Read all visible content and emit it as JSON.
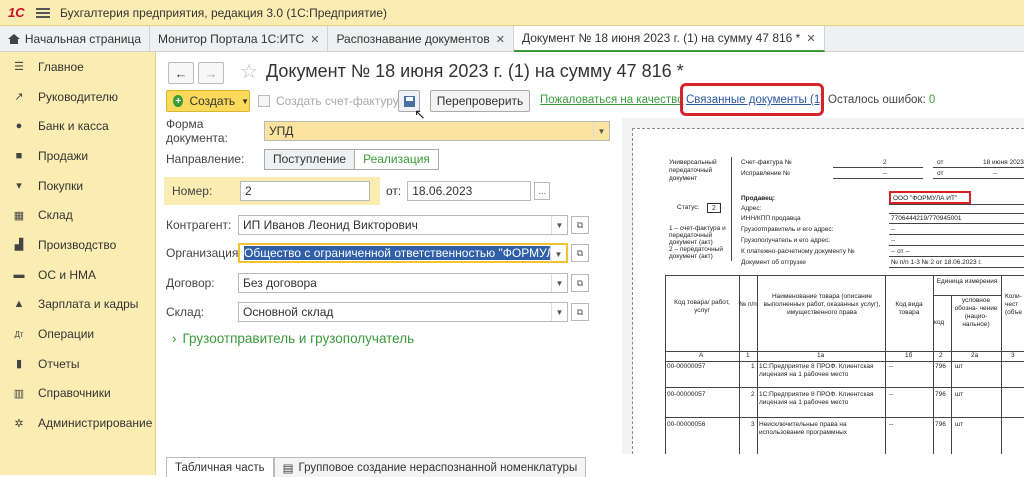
{
  "window": {
    "logo": "1С",
    "title": "Бухгалтерия предприятия, редакция 3.0  (1С:Предприятие)"
  },
  "tabs": [
    {
      "label": "Начальная страница"
    },
    {
      "label": "Монитор Портала 1С:ИТС"
    },
    {
      "label": "Распознавание документов"
    },
    {
      "label": "Документ № 18 июня 2023 г. (1) на сумму 47 816 *"
    }
  ],
  "sidebar": {
    "items": [
      {
        "label": "Главное",
        "icon": "menu-icon"
      },
      {
        "label": "Руководителю",
        "icon": "trend-icon"
      },
      {
        "label": "Банк и касса",
        "icon": "coins-icon"
      },
      {
        "label": "Продажи",
        "icon": "bag-icon"
      },
      {
        "label": "Покупки",
        "icon": "cart-icon"
      },
      {
        "label": "Склад",
        "icon": "warehouse-icon"
      },
      {
        "label": "Производство",
        "icon": "factory-icon"
      },
      {
        "label": "ОС и НМА",
        "icon": "truck-icon"
      },
      {
        "label": "Зарплата и кадры",
        "icon": "people-icon"
      },
      {
        "label": "Операции",
        "icon": "dt-kt-icon"
      },
      {
        "label": "Отчеты",
        "icon": "chart-icon"
      },
      {
        "label": "Справочники",
        "icon": "books-icon"
      },
      {
        "label": "Администрирование",
        "icon": "gear-icon"
      }
    ]
  },
  "header": {
    "title": "Документ № 18 июня 2023 г. (1) на сумму 47 816 *"
  },
  "toolbar": {
    "create": "Создать",
    "invoice": "Создать счет-фактуру",
    "recheck": "Перепроверить",
    "complain": "Пожаловаться на качество",
    "related": "Связанные документы (1)",
    "errors_label": "Осталось ошибок:",
    "errors_value": "0"
  },
  "form": {
    "doc_form_label": "Форма документа:",
    "doc_form_value": "УПД",
    "direction_label": "Направление:",
    "direction_in": "Поступление",
    "direction_out": "Реализация",
    "number_label": "Номер:",
    "number_value": "2",
    "date_label": "от:",
    "date_value": "18.06.2023",
    "date_btn": "...",
    "counterparty_label": "Контрагент:",
    "counterparty_value": "ИП Иванов Леонид Викторович",
    "org_label": "Организация:",
    "org_value": "Общество с ограниченной ответственностью \"ФОРМУЛА И",
    "contract_label": "Договор:",
    "contract_value": "Без договора",
    "warehouse_label": "Склад:",
    "warehouse_value": "Основной склад",
    "expander": "Грузоотправитель и грузополучатель"
  },
  "bottom_tabs": [
    {
      "label": "Табличная часть"
    },
    {
      "label": "Групповое создание нераспознанной номенклатуры"
    }
  ],
  "preview": {
    "upd1": "Универсальный",
    "upd2": "передаточный",
    "upd3": "документ",
    "invoice_no": "Счет-фактура №",
    "invoice_no_val": "2",
    "invoice_from": "от",
    "invoice_date": "18 июня 2023",
    "correction": "Исправление №",
    "correction_val": "--",
    "correction_from": "от",
    "correction_date": "--",
    "status": "Статус:",
    "status_val": "2",
    "seller": "Продавец:",
    "seller_val": "ООО \"ФОРМУЛА ИТ\"",
    "address": "Адрес:",
    "inn": "ИНН/КПП продавца",
    "inn_val": "7706444219/770945001",
    "shipper": "Грузоотправитель и его адрес:",
    "shipper_val": "--",
    "consignee": "Грузополучатель и его адрес:",
    "consignee_val": "--",
    "payment": "К платежно-расчетному документу №",
    "payment_val": "-- от --",
    "shipdoc": "Документ об отгрузке",
    "shipdoc_val": "№ п/п 1-3 № 2 от 18.06.2023 г.",
    "note1": "1 – счет-фактура и",
    "note2": "передаточный",
    "note3": "документ (акт)",
    "note4": "2 – передаточный",
    "note5": "документ (акт)",
    "col_code": "Код товара/ работ, услуг",
    "col_num": "№ п/п",
    "col_name": "Наименование товара (описание выполненных работ, оказанных услуг), имущественного права",
    "col_kind": "Код вида товара",
    "col_unit": "Единица измерения",
    "col_unit_code": "код",
    "col_unit_name": "условное обозна- чение (нацио- нальное)",
    "col_qty": "Коли- чест (объе",
    "row_letters": [
      "А",
      "1",
      "1а",
      "1б",
      "2",
      "2а",
      "3"
    ],
    "rows": [
      {
        "code": "00-00000057",
        "n": "1",
        "name": "1С:Предприятие 8 ПРОФ. Клиентская лицензия на 1 рабочее место",
        "kind": "--",
        "ucode": "796",
        "uname": "шт"
      },
      {
        "code": "00-00000057",
        "n": "2",
        "name": "1С:Предприятие 8 ПРОФ. Клиентская лицензия на 1 рабочее место",
        "kind": "--",
        "ucode": "796",
        "uname": "шт"
      },
      {
        "code": "00-00000056",
        "n": "3",
        "name": "Неисключительные права на использование программных",
        "kind": "--",
        "ucode": "796",
        "uname": "шт"
      }
    ]
  }
}
